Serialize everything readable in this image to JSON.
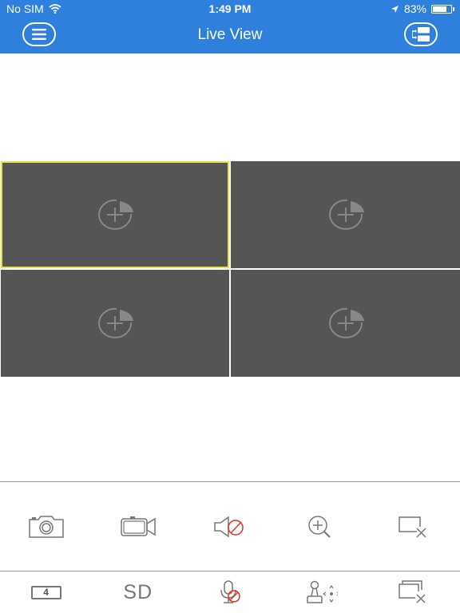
{
  "status_bar": {
    "carrier": "No SIM",
    "time": "1:49 PM",
    "battery": "83%",
    "battery_level": 0.83,
    "icons": [
      "wifi-icon",
      "location-arrow-icon",
      "battery-icon"
    ]
  },
  "nav": {
    "title": "Live View",
    "left_icon": "menu-icon",
    "right_icon": "split-view-icon"
  },
  "grid": {
    "tiles": [
      {
        "icon": "add-camera-icon",
        "selected": true
      },
      {
        "icon": "add-camera-icon",
        "selected": false
      },
      {
        "icon": "add-camera-icon",
        "selected": false
      },
      {
        "icon": "add-camera-icon",
        "selected": false
      }
    ]
  },
  "toolbar_top": {
    "icons": [
      "camera-snapshot-icon",
      "video-record-icon",
      "speaker-muted-icon",
      "zoom-in-icon",
      "close-window-icon"
    ]
  },
  "toolbar_bottom": {
    "split_count": "4",
    "quality": "SD",
    "icons": [
      "split-count-icon",
      "stream-quality-button",
      "microphone-muted-icon",
      "ptz-joystick-icon",
      "close-all-windows-icon"
    ]
  },
  "colors": {
    "accent": "#2f7fdc",
    "tile": "#555555",
    "selected_border": "#e8e24a",
    "muted_red": "#e0302a"
  }
}
